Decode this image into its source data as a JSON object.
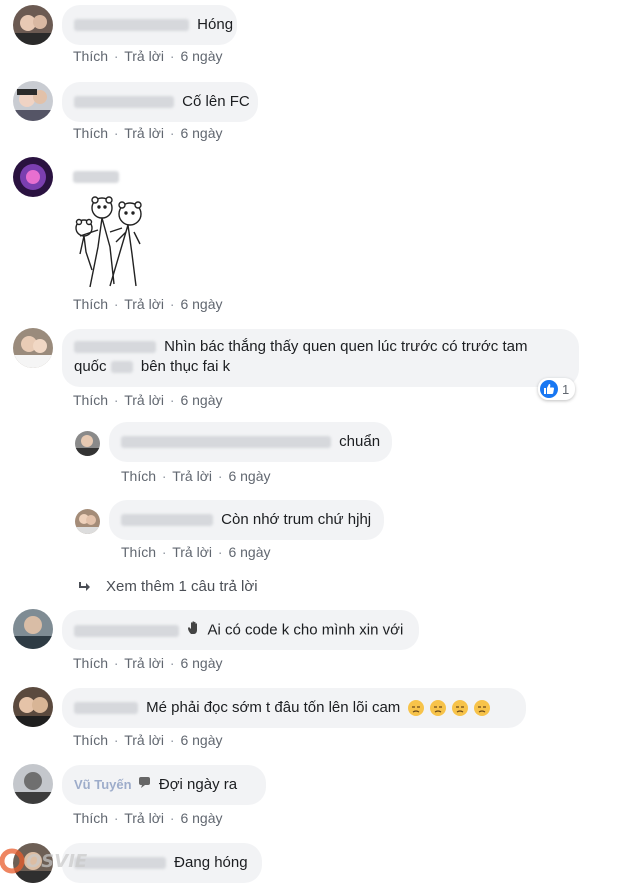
{
  "actions": {
    "like": "Thích",
    "reply": "Trả lời",
    "time": "6 ngày",
    "sep": "·"
  },
  "comments": [
    {
      "text": "Hóng"
    },
    {
      "text": "Cố lên FC"
    },
    {
      "text": ""
    },
    {
      "line1": "Nhìn bác thắng thấy quen quen lúc trước có trước tam",
      "prefix2": "quốc",
      "line2": "bên thục fai k",
      "reactions": "1"
    },
    {
      "text": "chuẩn"
    },
    {
      "text": "Còn nhớ trum chứ hjhj"
    },
    {
      "text": "Ai có code k cho mình xin với"
    },
    {
      "text": "Mé phải đọc sớm t đâu tốn lên lõi cam"
    },
    {
      "name": "Vũ Tuyến",
      "text": "Đợi ngày ra"
    },
    {
      "text": "Đang hóng"
    }
  ],
  "more_replies": "Xem thêm 1 câu trả lời",
  "colors": {
    "bubble": "#f2f3f5",
    "text": "#1c1e21",
    "meta": "#616770",
    "like": "#1877f2"
  }
}
